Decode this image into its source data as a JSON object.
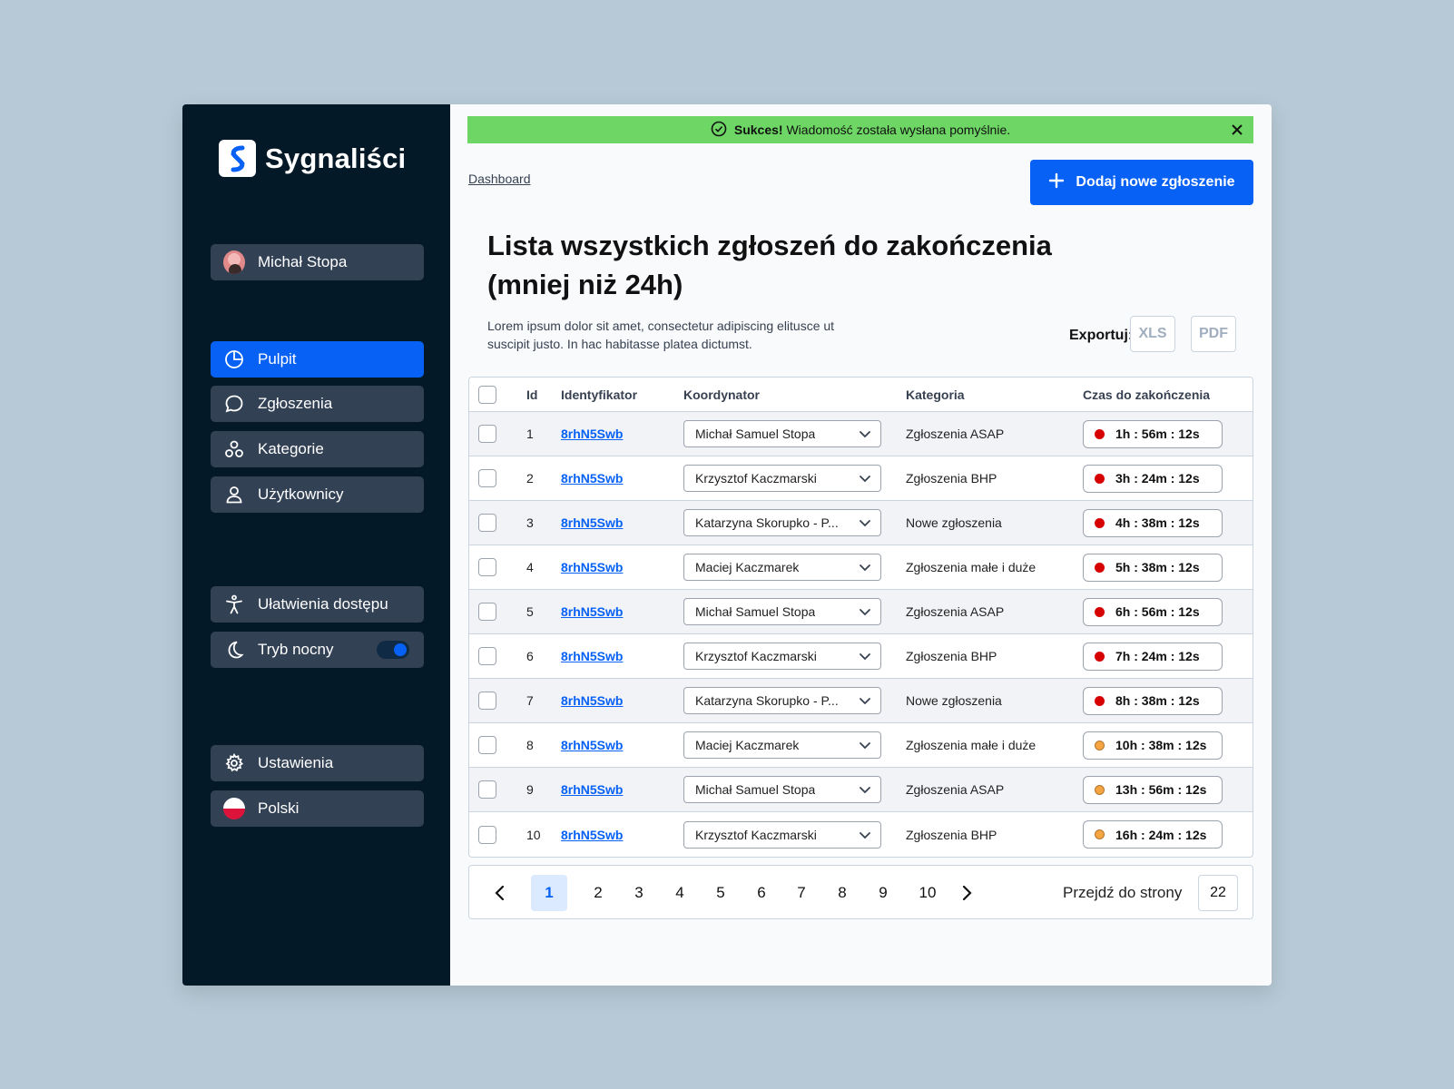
{
  "brand": {
    "name": "Sygnaliści"
  },
  "user": {
    "name": "Michał Stopa"
  },
  "nav": {
    "dashboard": "Pulpit",
    "reports": "Zgłoszenia",
    "categories": "Kategorie",
    "users": "Użytkownicy",
    "accessibility": "Ułatwienia dostępu",
    "night_mode": "Tryb nocny",
    "settings": "Ustawienia",
    "language": "Polski"
  },
  "alert": {
    "strong": "Sukces!",
    "message": "Wiadomość została wysłana pomyślnie."
  },
  "breadcrumb": "Dashboard",
  "add_button": "Dodaj nowe zgłoszenie",
  "title": "Lista wszystkich zgłoszeń do zakończenia (mniej niż 24h)",
  "description": "Lorem ipsum dolor sit amet, consectetur adipiscing elitusce ut suscipit justo. In hac habitasse platea dictumst.",
  "export": {
    "label": "Exportuj:",
    "xls": "XLS",
    "pdf": "PDF"
  },
  "table": {
    "headers": {
      "id": "Id",
      "identifier": "Identyfikator",
      "coordinator": "Koordynator",
      "category": "Kategoria",
      "time": "Czas do zakończenia"
    },
    "rows": [
      {
        "id": "1",
        "identifier": "8rhN5Swb",
        "coordinator": "Michał Samuel Stopa",
        "category": "Zgłoszenia ASAP",
        "time": "1h : 56m : 12s",
        "status": "red"
      },
      {
        "id": "2",
        "identifier": "8rhN5Swb",
        "coordinator": "Krzysztof Kaczmarski",
        "category": "Zgłoszenia BHP",
        "time": "3h : 24m : 12s",
        "status": "red"
      },
      {
        "id": "3",
        "identifier": "8rhN5Swb",
        "coordinator": "Katarzyna Skorupko - P...",
        "category": "Nowe zgłoszenia",
        "time": "4h : 38m : 12s",
        "status": "red"
      },
      {
        "id": "4",
        "identifier": "8rhN5Swb",
        "coordinator": "Maciej Kaczmarek",
        "category": "Zgłoszenia małe i duże",
        "time": "5h : 38m : 12s",
        "status": "red"
      },
      {
        "id": "5",
        "identifier": "8rhN5Swb",
        "coordinator": "Michał Samuel Stopa",
        "category": "Zgłoszenia ASAP",
        "time": "6h : 56m : 12s",
        "status": "red"
      },
      {
        "id": "6",
        "identifier": "8rhN5Swb",
        "coordinator": "Krzysztof Kaczmarski",
        "category": "Zgłoszenia BHP",
        "time": "7h : 24m : 12s",
        "status": "red"
      },
      {
        "id": "7",
        "identifier": "8rhN5Swb",
        "coordinator": "Katarzyna Skorupko - P...",
        "category": "Nowe zgłoszenia",
        "time": "8h : 38m : 12s",
        "status": "red"
      },
      {
        "id": "8",
        "identifier": "8rhN5Swb",
        "coordinator": "Maciej Kaczmarek",
        "category": "Zgłoszenia małe i duże",
        "time": "10h : 38m : 12s",
        "status": "orange"
      },
      {
        "id": "9",
        "identifier": "8rhN5Swb",
        "coordinator": "Michał Samuel Stopa",
        "category": "Zgłoszenia ASAP",
        "time": "13h : 56m : 12s",
        "status": "orange"
      },
      {
        "id": "10",
        "identifier": "8rhN5Swb",
        "coordinator": "Krzysztof Kaczmarski",
        "category": "Zgłoszenia BHP",
        "time": "16h : 24m : 12s",
        "status": "orange"
      }
    ]
  },
  "pagination": {
    "pages": [
      "1",
      "2",
      "3",
      "4",
      "5",
      "6",
      "7",
      "8",
      "9",
      "10"
    ],
    "current": "1",
    "goto_label": "Przejdź do strony",
    "goto_value": "22"
  },
  "colors": {
    "primary": "#0761f5",
    "sidebar": "#031927",
    "success": "#6dd664",
    "urgent": "#d70000",
    "warning": "#f5a442"
  }
}
